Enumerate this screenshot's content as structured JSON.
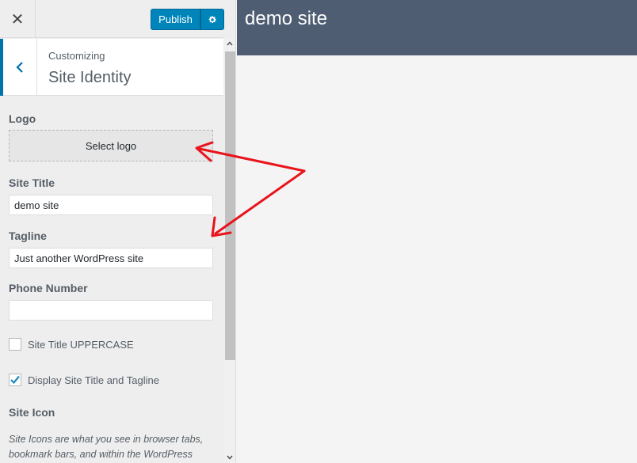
{
  "topbar": {
    "close_icon": "close-icon",
    "publish_label": "Publish",
    "settings_icon": "gear-icon"
  },
  "section": {
    "breadcrumb": "Customizing",
    "title": "Site Identity",
    "back_icon": "chevron-left-icon"
  },
  "controls": {
    "logo_label": "Logo",
    "select_logo_label": "Select logo",
    "site_title_label": "Site Title",
    "site_title_value": "demo site",
    "tagline_label": "Tagline",
    "tagline_value": "Just another WordPress site",
    "phone_label": "Phone Number",
    "phone_value": "",
    "uppercase_label": "Site Title UPPERCASE",
    "uppercase_checked": false,
    "display_title_label": "Display Site Title and Tagline",
    "display_title_checked": true,
    "site_icon_label": "Site Icon",
    "site_icon_desc": "Site Icons are what you see in browser tabs, bookmark bars, and within the WordPress"
  },
  "preview": {
    "site_title": "demo site"
  },
  "colors": {
    "accent": "#0085ba",
    "preview_header": "#4f5d72",
    "annotation_arrow": "#e8141b"
  }
}
